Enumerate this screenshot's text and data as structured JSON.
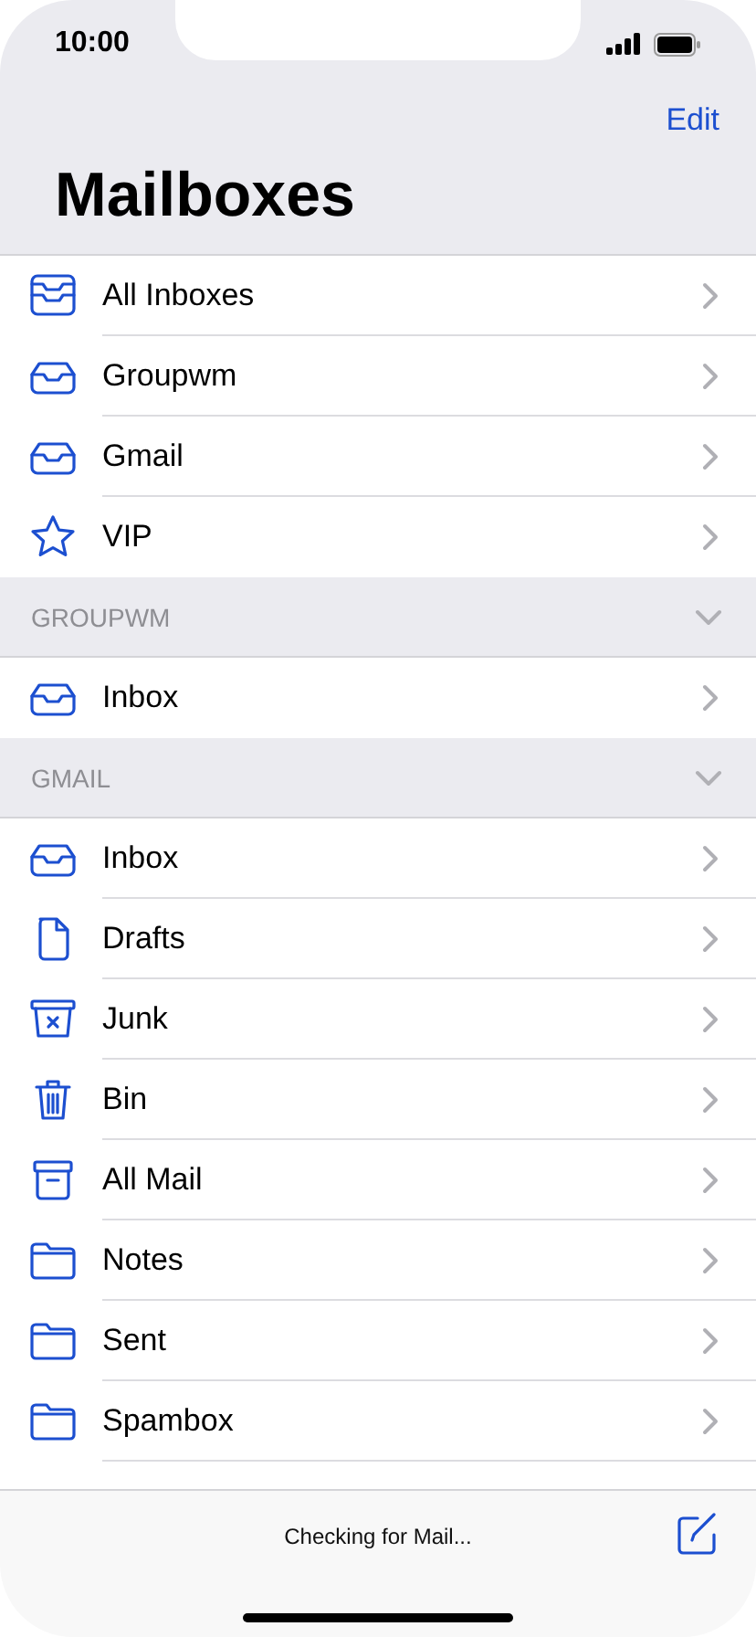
{
  "status_bar": {
    "time": "10:00"
  },
  "nav": {
    "edit": "Edit",
    "title": "Mailboxes"
  },
  "sections": [
    {
      "items": [
        {
          "label": "All Inboxes",
          "kind": "all-inboxes"
        },
        {
          "label": "Groupwm",
          "kind": "inbox"
        },
        {
          "label": "Gmail",
          "kind": "inbox"
        },
        {
          "label": "VIP",
          "kind": "star"
        }
      ]
    },
    {
      "header": "GROUPWM",
      "expanded": true,
      "items": [
        {
          "label": "Inbox",
          "kind": "inbox"
        }
      ]
    },
    {
      "header": "GMAIL",
      "expanded": true,
      "items": [
        {
          "label": "Inbox",
          "kind": "inbox"
        },
        {
          "label": "Drafts",
          "kind": "document"
        },
        {
          "label": "Junk",
          "kind": "junk"
        },
        {
          "label": "Bin",
          "kind": "bin"
        },
        {
          "label": "All Mail",
          "kind": "archive"
        },
        {
          "label": "Notes",
          "kind": "folder"
        },
        {
          "label": "Sent",
          "kind": "folder"
        },
        {
          "label": "Spambox",
          "kind": "folder"
        }
      ]
    }
  ],
  "toolbar": {
    "status": "Checking for Mail..."
  }
}
